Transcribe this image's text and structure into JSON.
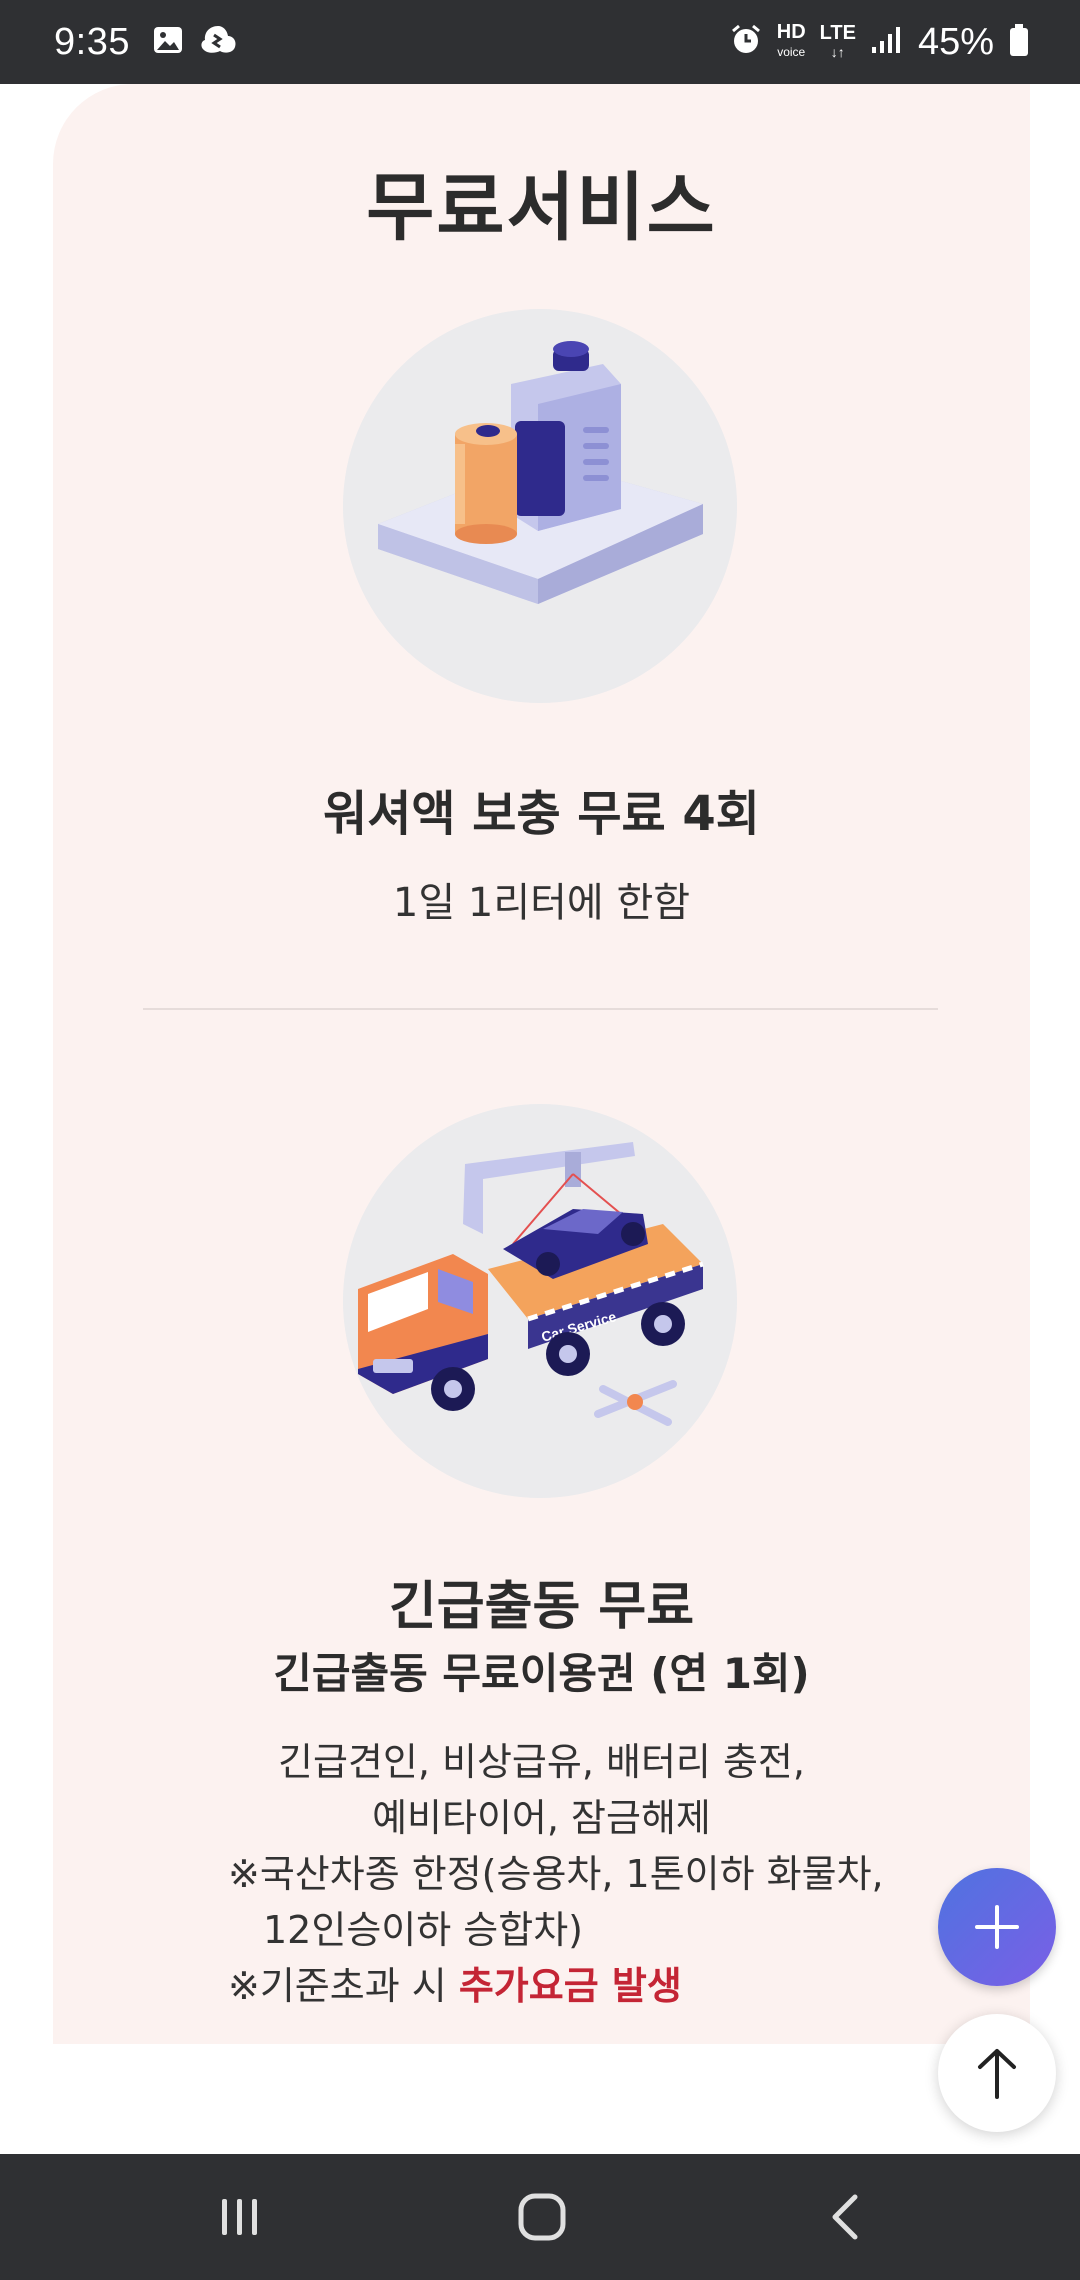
{
  "status_bar": {
    "time": "9:35",
    "hd_label": "HD",
    "voice_label": "voice",
    "lte_label": "LTE",
    "battery": "45%"
  },
  "page": {
    "section_title": "무료서비스",
    "items": [
      {
        "title": "워셔액 보충 무료 4회",
        "subtitle": "1일 1리터에 한함",
        "illustration": "washer-fluid-icon"
      },
      {
        "title": "긴급출동 무료",
        "subtitle": "긴급출동 무료이용권 (연 1회)",
        "illustration": "tow-truck-icon",
        "illustration_text": "Car Service",
        "desc_line1": "긴급견인, 비상급유, 배터리 충전,",
        "desc_line2": "예비타이어, 잠금해제",
        "note1_line1": "※국산차종 한정(승용차, 1톤이하 화물차,",
        "note1_line2": "12인승이하 승합차)",
        "note2_prefix": "※기준초과 시 ",
        "note2_highlight": "추가요금 발생"
      }
    ]
  },
  "fabs": {
    "plus_icon": "plus-icon",
    "top_icon": "arrow-up-icon"
  },
  "nav_bar": {
    "recents_icon": "recents-icon",
    "home_icon": "home-icon",
    "back_icon": "back-icon"
  },
  "colors": {
    "card_bg": "#fcf2f0",
    "highlight": "#c42535",
    "fab_gradient_start": "#4f73e0",
    "fab_gradient_end": "#7a5fe6",
    "system_bar": "#2f3033"
  }
}
